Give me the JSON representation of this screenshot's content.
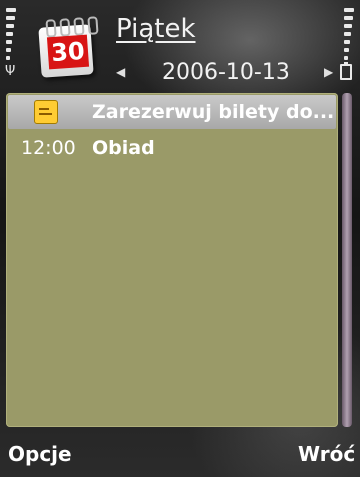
{
  "header": {
    "day_title": "Piątek",
    "date": "2006-10-13",
    "calendar_day": "30"
  },
  "entries": [
    {
      "time": "",
      "title": "Zarezerwuj bilety do...",
      "icon": "todo-icon",
      "selected": true
    },
    {
      "time": "12:00",
      "title": "Obiad",
      "icon": "",
      "selected": false
    }
  ],
  "softkeys": {
    "left": "Opcje",
    "right": "Wróć"
  },
  "colors": {
    "list_background": "#9a9a68",
    "selection": "#bdbdbd"
  }
}
